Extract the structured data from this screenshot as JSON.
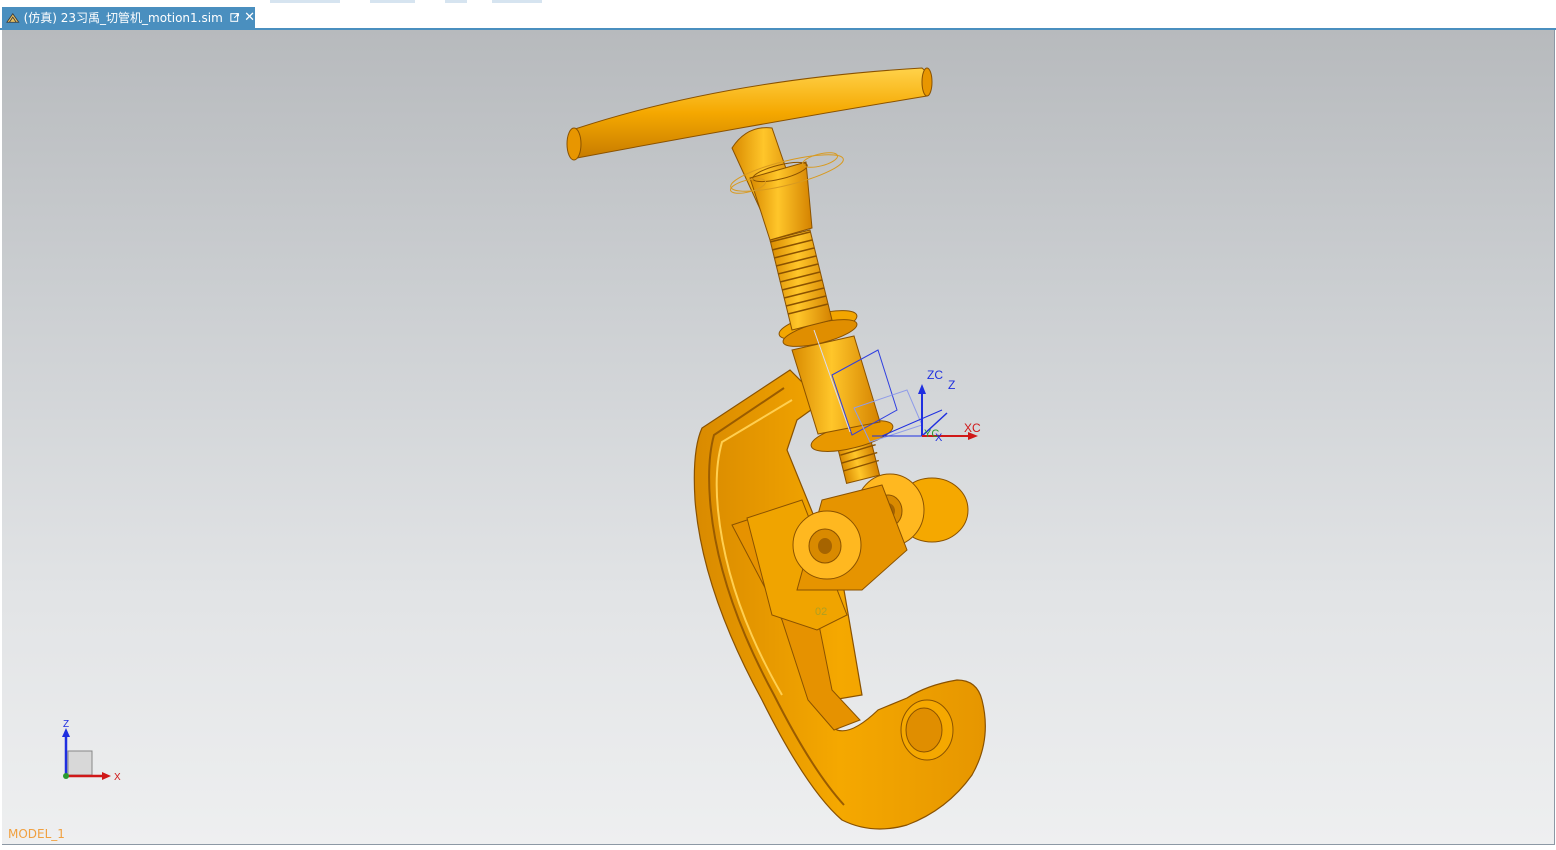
{
  "tab": {
    "title": "(仿真) 23习禹_切管机_motion1.sim",
    "app_icon": "nx-sim-icon",
    "popout_icon": "popout-icon",
    "close_symbol": "✕"
  },
  "viewport": {
    "model_name": "MODEL_1",
    "csys_labels": {
      "zc": "ZC",
      "z": "Z",
      "xc": "XC",
      "x": "X",
      "yc": "YC"
    },
    "marker_label": "02",
    "triad_labels": {
      "z": "Z",
      "x": "X"
    },
    "colors": {
      "part": "#f5a800",
      "part_dark": "#d98a00",
      "background_top": "#b7babd",
      "background_bottom": "#eeeff0",
      "csys_blue": "#1f2fe0",
      "csys_red": "#d01818"
    }
  }
}
